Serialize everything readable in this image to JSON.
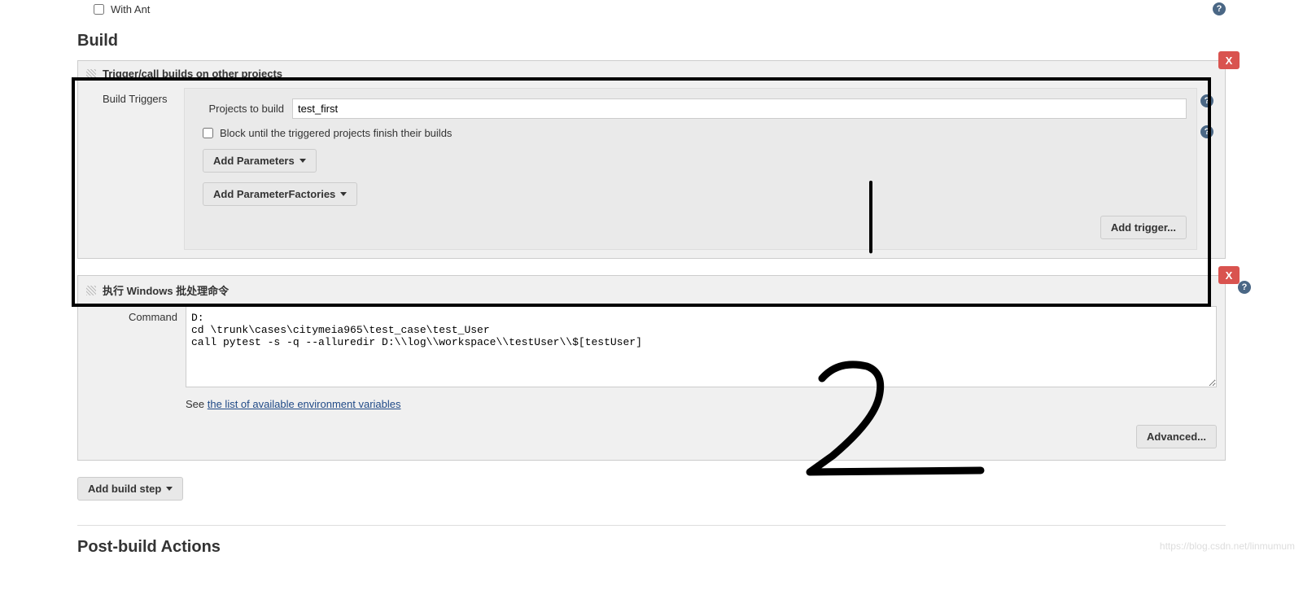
{
  "withAnt": {
    "label": "With Ant",
    "checked": false
  },
  "sections": {
    "build": "Build",
    "postBuild": "Post-build Actions"
  },
  "trigger": {
    "panelTitle": "Trigger/call builds on other projects",
    "sideLabel": "Build Triggers",
    "projectsLabel": "Projects to build",
    "projectsValue": "test_first",
    "blockLabel": "Block until the triggered projects finish their builds",
    "blockChecked": false,
    "addParams": "Add Parameters",
    "addFactories": "Add ParameterFactories",
    "addTrigger": "Add trigger..."
  },
  "batch": {
    "panelTitle": "执行 Windows 批处理命令",
    "commandLabel": "Command",
    "commandValue": "D:\ncd \\trunk\\cases\\citymeia965\\test_case\\test_User\ncall pytest -s -q --alluredir D:\\\\log\\\\workspace\\\\testUser\\\\$[testUser]",
    "seePrefix": "See ",
    "seeLink": "the list of available environment variables",
    "advanced": "Advanced..."
  },
  "addBuildStep": "Add build step",
  "closeLabel": "X",
  "help": "?",
  "watermark": "https://blog.csdn.net/linmumum"
}
